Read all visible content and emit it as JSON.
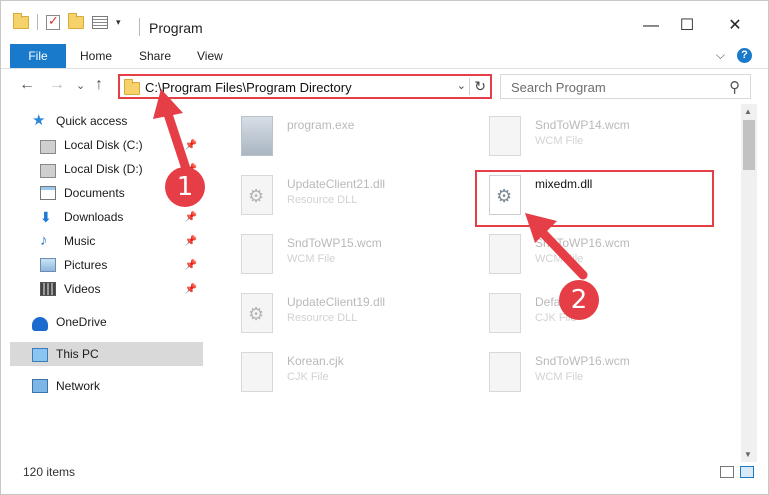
{
  "window": {
    "title": "Program",
    "controls": {
      "minimize": "—",
      "maximize": "☐",
      "close": "✕"
    }
  },
  "ribbon": {
    "tabs": [
      "File",
      "Home",
      "Share",
      "View"
    ],
    "expand": "⌵",
    "help": "?"
  },
  "nav": {
    "back": "←",
    "forward": "→",
    "recent": "⌄",
    "up": "↑",
    "address": "C:\\Program Files\\Program Directory",
    "address_dropdown": "⌄",
    "refresh": "↻",
    "search_placeholder": "Search Program",
    "search_icon": "⚲"
  },
  "sidebar": {
    "items": [
      {
        "label": "Quick access",
        "icon": "star-icon",
        "pinned": false
      },
      {
        "label": "Local Disk (C:)",
        "icon": "disk-icon",
        "pinned": true
      },
      {
        "label": "Local Disk (D:)",
        "icon": "disk-icon",
        "pinned": true
      },
      {
        "label": "Documents",
        "icon": "documents-icon",
        "pinned": true
      },
      {
        "label": "Downloads",
        "icon": "downloads-icon",
        "pinned": true
      },
      {
        "label": "Music",
        "icon": "music-icon",
        "pinned": true
      },
      {
        "label": "Pictures",
        "icon": "pictures-icon",
        "pinned": true
      },
      {
        "label": "Videos",
        "icon": "videos-icon",
        "pinned": true
      },
      {
        "label": "OneDrive",
        "icon": "onedrive-icon",
        "pinned": false
      },
      {
        "label": "This PC",
        "icon": "this-pc-icon",
        "pinned": false,
        "selected": true
      },
      {
        "label": "Network",
        "icon": "network-icon",
        "pinned": false
      }
    ],
    "pin_glyph": "📌"
  },
  "files": [
    {
      "name": "program.exe",
      "type": "",
      "icon": "exe"
    },
    {
      "name": "SndToWP14.wcm",
      "type": "WCM File",
      "icon": "doc"
    },
    {
      "name": "UpdateClient21.dll",
      "type": "Resource DLL",
      "icon": "dll"
    },
    {
      "name": "mixedm.dll",
      "type": "",
      "icon": "dll",
      "active": true
    },
    {
      "name": "SndToWP15.wcm",
      "type": "WCM File",
      "icon": "doc"
    },
    {
      "name": "SndToWP16.wcm",
      "type": "WCM File",
      "icon": "doc"
    },
    {
      "name": "UpdateClient19.dll",
      "type": "Resource DLL",
      "icon": "dll"
    },
    {
      "name": "Default.cjk",
      "type": "CJK File",
      "icon": "doc"
    },
    {
      "name": "Korean.cjk",
      "type": "CJK File",
      "icon": "doc"
    },
    {
      "name": "SndToWP16.wcm",
      "type": "WCM File",
      "icon": "doc"
    }
  ],
  "status": {
    "item_count": "120 items"
  },
  "annotations": {
    "step1": "1",
    "step2": "2",
    "color": "#e53e46"
  }
}
